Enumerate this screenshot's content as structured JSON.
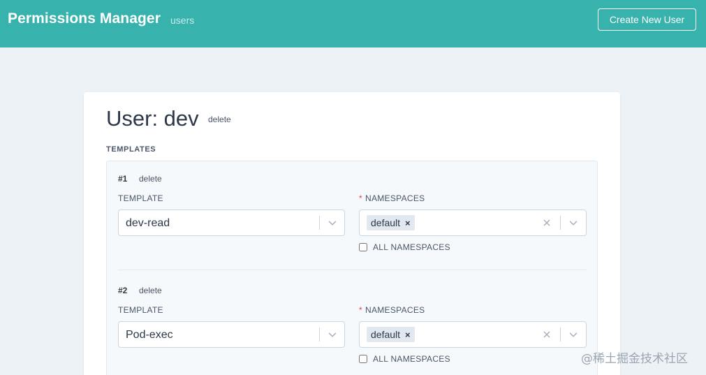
{
  "header": {
    "title": "Permissions Manager",
    "nav_users": "users",
    "create_button": "Create New User"
  },
  "user": {
    "title": "User: dev",
    "delete_label": "delete"
  },
  "templates_heading": "TEMPLATES",
  "templates": [
    {
      "number": "#1",
      "delete_label": "delete",
      "template_label": "TEMPLATE",
      "template_value": "dev-read",
      "namespaces_required": "*",
      "namespaces_label": "NAMESPACES",
      "namespace_chip": "default",
      "chip_remove": "×",
      "all_namespaces_label": "ALL NAMESPACES",
      "all_namespaces_checked": false
    },
    {
      "number": "#2",
      "delete_label": "delete",
      "template_label": "TEMPLATE",
      "template_value": "Pod-exec",
      "namespaces_required": "*",
      "namespaces_label": "NAMESPACES",
      "namespace_chip": "default",
      "chip_remove": "×",
      "all_namespaces_label": "ALL NAMESPACES",
      "all_namespaces_checked": false
    }
  ],
  "watermark": "@稀土掘金技术社区",
  "colors": {
    "header_bg": "#38b2ac",
    "page_bg": "#edf2f7",
    "required": "#e53e3e"
  },
  "icons": {
    "dropdown": "chevron-down-icon",
    "clear": "clear-icon"
  }
}
